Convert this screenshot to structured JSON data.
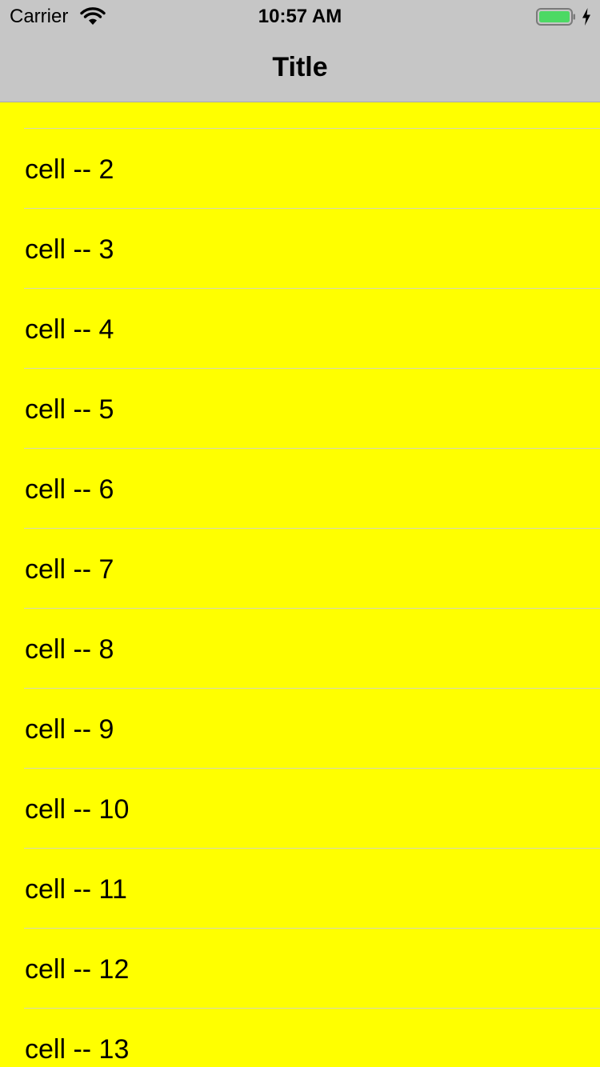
{
  "status_bar": {
    "carrier": "Carrier",
    "time": "10:57 AM",
    "battery_color": "#4cd964",
    "icons": [
      "wifi-icon",
      "battery-icon",
      "charging-bolt-icon"
    ]
  },
  "nav_bar": {
    "title": "Title",
    "background": "#c6c6c6"
  },
  "table": {
    "background": "#ffff00",
    "cells": [
      {
        "label": "cell -- 2"
      },
      {
        "label": "cell -- 3"
      },
      {
        "label": "cell -- 4"
      },
      {
        "label": "cell -- 5"
      },
      {
        "label": "cell -- 6"
      },
      {
        "label": "cell -- 7"
      },
      {
        "label": "cell -- 8"
      },
      {
        "label": "cell -- 9"
      },
      {
        "label": "cell -- 10"
      },
      {
        "label": "cell -- 11"
      },
      {
        "label": "cell -- 12"
      },
      {
        "label": "cell -- 13"
      }
    ]
  }
}
